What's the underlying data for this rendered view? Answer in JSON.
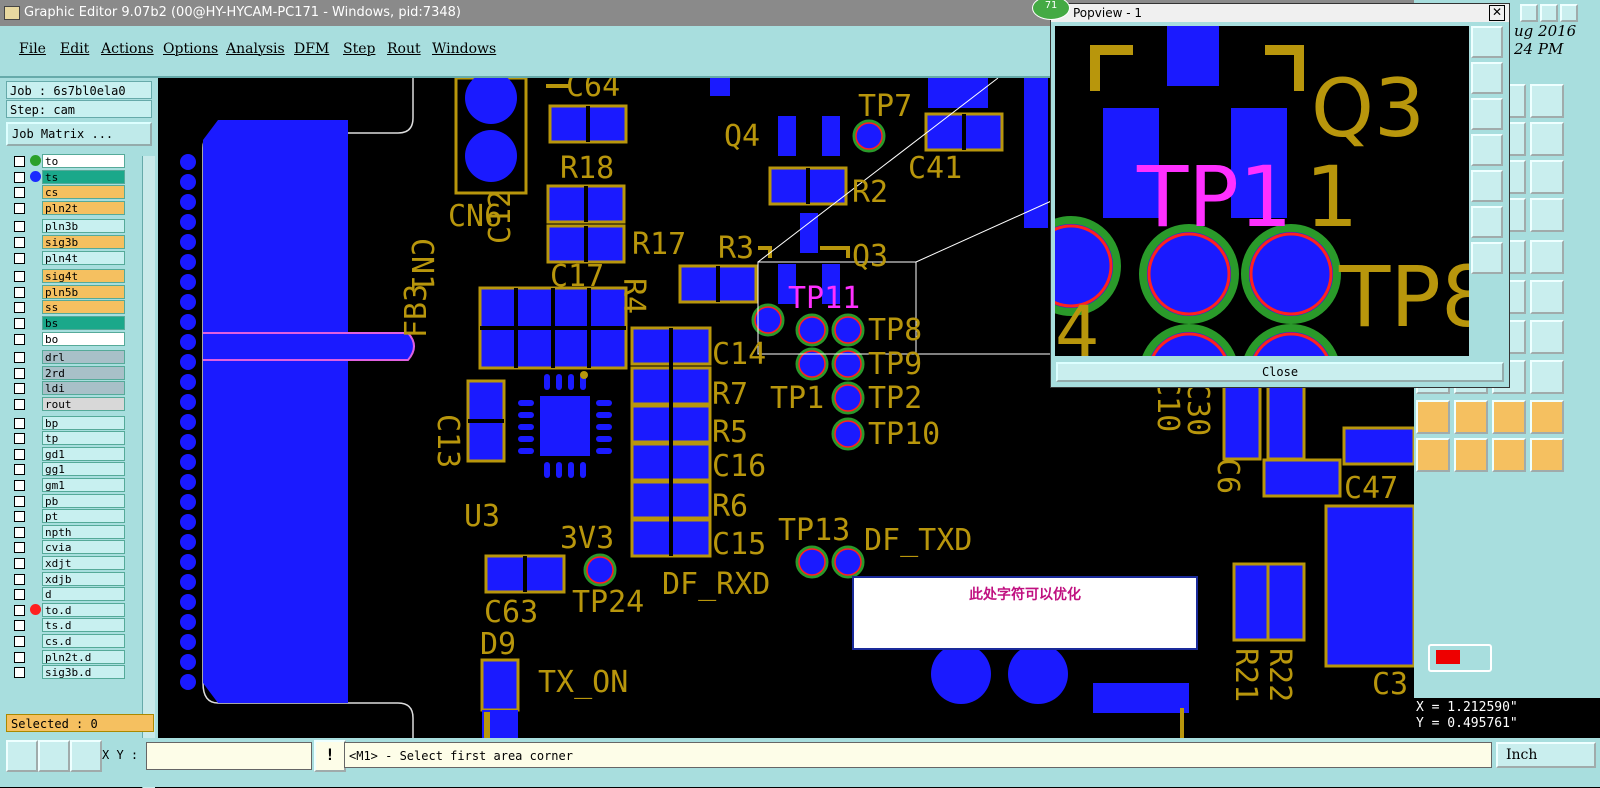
{
  "window": {
    "title": "Graphic Editor 9.07b2 (00@HY-HYCAM-PC171 - Windows, pid:7348)"
  },
  "menu": [
    "File",
    "Edit",
    "Actions",
    "Options",
    "Analysis",
    "DFM",
    "Step",
    "Rout",
    "Windows"
  ],
  "left_panel": {
    "job": "Job : 6s7bl0ela0",
    "step": "Step: cam",
    "job_matrix_label": "Job Matrix ...",
    "selected": "Selected : 0",
    "layers": [
      {
        "name": "to",
        "color": "#ffffff",
        "dot": "#2aa02a"
      },
      {
        "name": "ts",
        "color": "#1aa88a",
        "dot": "#1a2aff"
      },
      {
        "name": "cs",
        "color": "#f5c060",
        "dot": ""
      },
      {
        "name": "pln2t",
        "color": "#f5c060",
        "dot": ""
      },
      {
        "name": "pln3b",
        "color": "#c8f0f0",
        "dot": ""
      },
      {
        "name": "sig3b",
        "color": "#f5c060",
        "dot": ""
      },
      {
        "name": "pln4t",
        "color": "#c8f0f0",
        "dot": ""
      },
      {
        "name": "sig4t",
        "color": "#f5c060",
        "dot": ""
      },
      {
        "name": "pln5b",
        "color": "#f5c060",
        "dot": ""
      },
      {
        "name": "ss",
        "color": "#f5c060",
        "dot": ""
      },
      {
        "name": "bs",
        "color": "#1aa88a",
        "dot": ""
      },
      {
        "name": "bo",
        "color": "#ffffff",
        "dot": ""
      },
      {
        "name": "drl",
        "color": "#a8c0c8",
        "dot": ""
      },
      {
        "name": "2rd",
        "color": "#a8c0c8",
        "dot": ""
      },
      {
        "name": "ldi",
        "color": "#a8c0c8",
        "dot": ""
      },
      {
        "name": "rout",
        "color": "#d8d8d8",
        "dot": ""
      },
      {
        "name": "bp",
        "color": "#c8f0f0",
        "dot": ""
      },
      {
        "name": "tp",
        "color": "#c8f0f0",
        "dot": ""
      },
      {
        "name": "gd1",
        "color": "#c8f0f0",
        "dot": ""
      },
      {
        "name": "gg1",
        "color": "#c8f0f0",
        "dot": ""
      },
      {
        "name": "gm1",
        "color": "#c8f0f0",
        "dot": ""
      },
      {
        "name": "pb",
        "color": "#c8f0f0",
        "dot": ""
      },
      {
        "name": "pt",
        "color": "#c8f0f0",
        "dot": ""
      },
      {
        "name": "npth",
        "color": "#c8f0f0",
        "dot": ""
      },
      {
        "name": "cvia",
        "color": "#c8f0f0",
        "dot": ""
      },
      {
        "name": "xdjt",
        "color": "#c8f0f0",
        "dot": ""
      },
      {
        "name": "xdjb",
        "color": "#c8f0f0",
        "dot": ""
      },
      {
        "name": "d",
        "color": "#c8f0f0",
        "dot": ""
      },
      {
        "name": "to.d",
        "color": "#c8f0f0",
        "dot": "#ff2020"
      },
      {
        "name": "ts.d",
        "color": "#c8f0f0",
        "dot": ""
      },
      {
        "name": "cs.d",
        "color": "#c8f0f0",
        "dot": ""
      },
      {
        "name": "pln2t.d",
        "color": "#c8f0f0",
        "dot": ""
      },
      {
        "name": "sig3b.d",
        "color": "#c8f0f0",
        "dot": ""
      }
    ]
  },
  "popview": {
    "title": "Popview - 1",
    "close_label": "Close",
    "badge": "71"
  },
  "right_panel": {
    "date_line1": "ug 2016",
    "date_line2": "24 PM",
    "x_readout": "X = 1.212590\"",
    "y_readout": "Y = 0.495761\""
  },
  "statusbar": {
    "xy_label": "X Y :",
    "message": "<M1> - Select first area corner",
    "unit": "Inch"
  },
  "annotation": "此处字符可以优化",
  "pcb_labels": [
    "C64",
    "TP7",
    "Q4",
    "R18",
    "R2",
    "C41",
    "CN6",
    "C12",
    "R17",
    "R3",
    "Q3",
    "CN1",
    "FB3",
    "C17",
    "R4",
    "TP11",
    "TP8",
    "C14",
    "TP9",
    "C13",
    "R7",
    "TP1",
    "TP2",
    "R5",
    "TP10",
    "C16",
    "U3",
    "R6",
    "3V3",
    "TP13",
    "DF_TXD",
    "C15",
    "DF_RXD",
    "C63",
    "TP24",
    "D9",
    "TX_ON",
    "C10",
    "C30",
    "C6",
    "C47",
    "R21",
    "R22",
    "C3"
  ],
  "popview_labels": [
    "Q3",
    "TP1",
    "TP8",
    "4"
  ]
}
